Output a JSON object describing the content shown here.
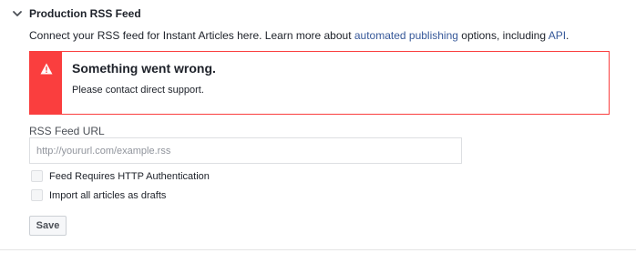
{
  "section": {
    "title": "Production RSS Feed",
    "expanded": true
  },
  "intro": {
    "text_before": "Connect your RSS feed for Instant Articles here. Learn more about ",
    "link1": "automated publishing",
    "text_middle": " options, including ",
    "link2": "API",
    "text_after": "."
  },
  "error": {
    "title": "Something went wrong.",
    "message": "Please contact direct support.",
    "icon": "warning-icon",
    "color": "#fa3e3e"
  },
  "rss_field": {
    "label": "RSS Feed URL",
    "value": "",
    "placeholder": "http://yoururl.com/example.rss"
  },
  "options": [
    {
      "label": "Feed Requires HTTP Authentication",
      "checked": false
    },
    {
      "label": "Import all articles as drafts",
      "checked": false
    }
  ],
  "actions": {
    "save_label": "Save"
  },
  "colors": {
    "link": "#365899",
    "error": "#fa3e3e",
    "text": "#1d2129"
  }
}
